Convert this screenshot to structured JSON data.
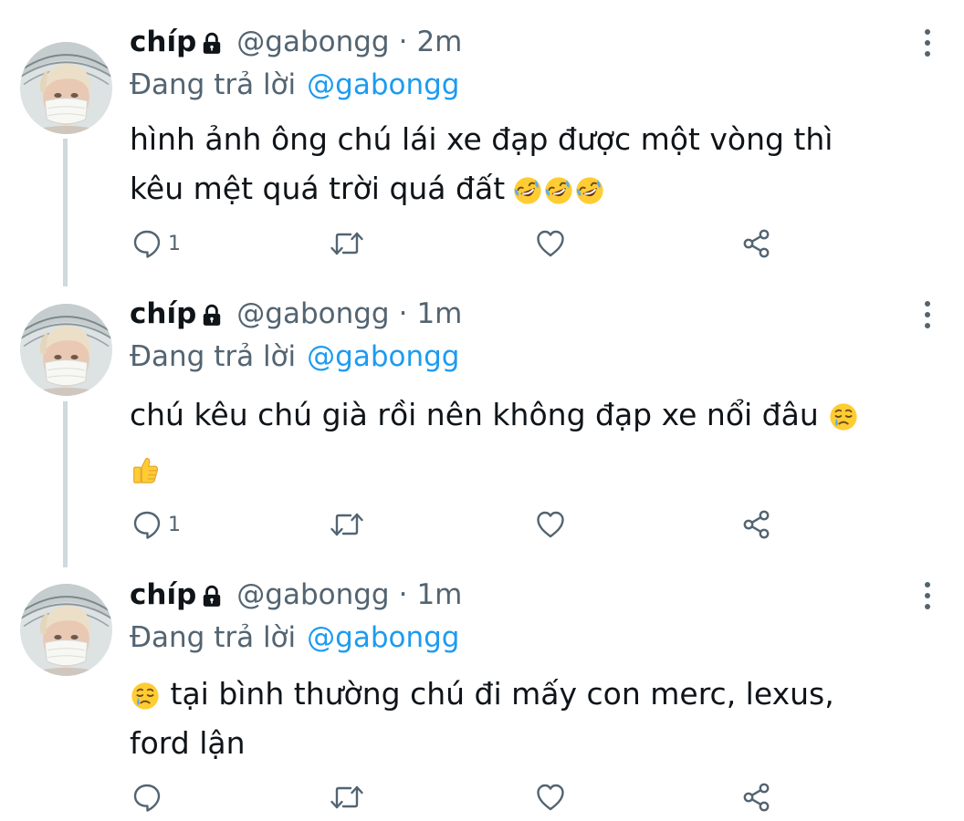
{
  "user": {
    "name": "chíp",
    "handle": "@gabongg"
  },
  "labels": {
    "replying_to": "Đang trả lời",
    "separator": "·"
  },
  "tweets": [
    {
      "time": "2m",
      "reply_handle": "@gabongg",
      "text_line1": "hình ảnh ông chú lái xe đạp được một vòng thì",
      "text_line2": "kêu mệt quá trời quá đất",
      "emojis": [
        "rofl-emoji",
        "rofl-emoji",
        "rofl-emoji"
      ],
      "reply_count": "1"
    },
    {
      "time": "1m",
      "reply_handle": "@gabongg",
      "text_line1": "chú kêu chú già rồi nên không đạp xe nổi đâu",
      "emojis": [
        "smiling-tear-emoji",
        "thumbs-up-emoji"
      ],
      "reply_count": "1"
    },
    {
      "time": "1m",
      "reply_handle": "@gabongg",
      "text_line1": "tại bình thường chú đi mấy con merc, lexus,",
      "text_line2": "ford lận",
      "emojis": [
        "smiling-tear-emoji"
      ],
      "reply_count": ""
    }
  ],
  "colors": {
    "text": "#0f1419",
    "secondary": "#536471",
    "link": "#1d9bf0",
    "thread_line": "#cfd9de"
  }
}
